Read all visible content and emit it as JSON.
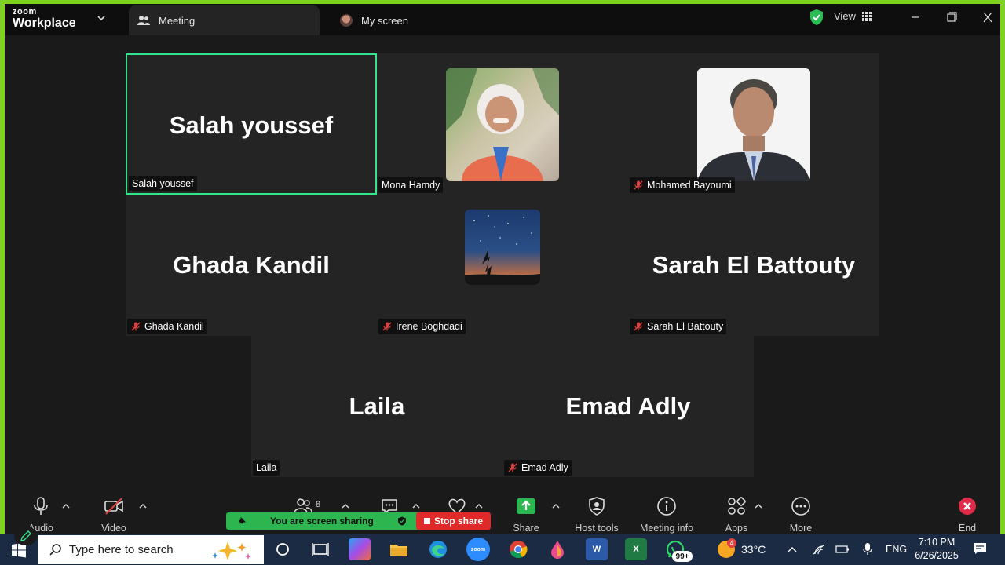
{
  "app": {
    "brand_line1": "zoom",
    "brand_line2": "Workplace"
  },
  "tabs": [
    {
      "label": "Meeting",
      "active": true
    },
    {
      "label": "My screen",
      "active": false
    }
  ],
  "view_label": "View",
  "participants": [
    {
      "name": "Salah youssef",
      "display": "Salah youssef",
      "muted": false,
      "speaking": true
    },
    {
      "name": "Mona Hamdy",
      "display": "",
      "muted": false,
      "photo": true
    },
    {
      "name": "Mohamed Bayoumi",
      "display": "",
      "muted": true,
      "photo": true
    },
    {
      "name": "Ghada Kandil",
      "display": "Ghada Kandil",
      "muted": true
    },
    {
      "name": "Irene Boghdadi",
      "display": "",
      "muted": true,
      "photo": true
    },
    {
      "name": "Sarah El Battouty",
      "display": "Sarah El Battouty",
      "muted": true
    },
    {
      "name": "Laila",
      "display": "Laila",
      "muted": false
    },
    {
      "name": "Emad Adly",
      "display": "Emad Adly",
      "muted": true
    }
  ],
  "toolbar": {
    "audio": "Audio",
    "video": "Video",
    "participants_count": "8",
    "share": "Share",
    "host_tools": "Host tools",
    "meeting_info": "Meeting info",
    "apps": "Apps",
    "more": "More",
    "end": "End",
    "sharing_status": "You are screen sharing",
    "stop_share": "Stop share"
  },
  "taskbar": {
    "search_placeholder": "Type here to search",
    "whatsapp_badge": "99+",
    "weather_badge": "4",
    "temperature": "33°C",
    "language": "ENG",
    "time": "7:10 PM",
    "date": "6/26/2025"
  },
  "colors": {
    "desktop_border": "#7ed321",
    "speaking_border": "#2ee88b",
    "share_green": "#2db54f",
    "stop_red": "#e02a2a",
    "end_red": "#e02a4a"
  }
}
